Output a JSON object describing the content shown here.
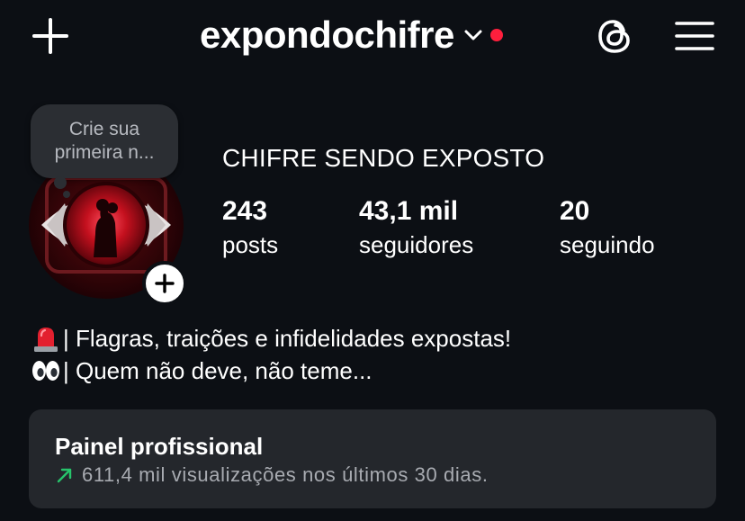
{
  "header": {
    "username": "expondochifre",
    "icons": {
      "new": "plus-icon",
      "switch": "chevron-down-icon",
      "threads": "threads-icon",
      "menu": "hamburger-menu-icon"
    },
    "notification_dot_color": "#ff1f3d"
  },
  "note": {
    "placeholder": "Crie sua primeira n..."
  },
  "profile": {
    "name": "CHIFRE SENDO EXPOSTO",
    "stats": [
      {
        "value": "243",
        "label": "posts"
      },
      {
        "value": "43,1 mil",
        "label": "seguidores"
      },
      {
        "value": "20",
        "label": "seguindo"
      }
    ]
  },
  "bio": {
    "line1": "| Flagras, traições e infidelidades expostas!",
    "line2": "| Quem não deve, não teme...",
    "line1_emoji": "police-light-emoji",
    "line2_emoji": "eyes-emoji"
  },
  "professional_dashboard": {
    "title": "Painel profissional",
    "subtitle": "611,4 mil visualizações nos últimos 30 dias.",
    "trend_color": "#27c46b"
  },
  "colors": {
    "background": "#0c0f14",
    "card": "#24272c",
    "bubble": "#2b2e33"
  }
}
